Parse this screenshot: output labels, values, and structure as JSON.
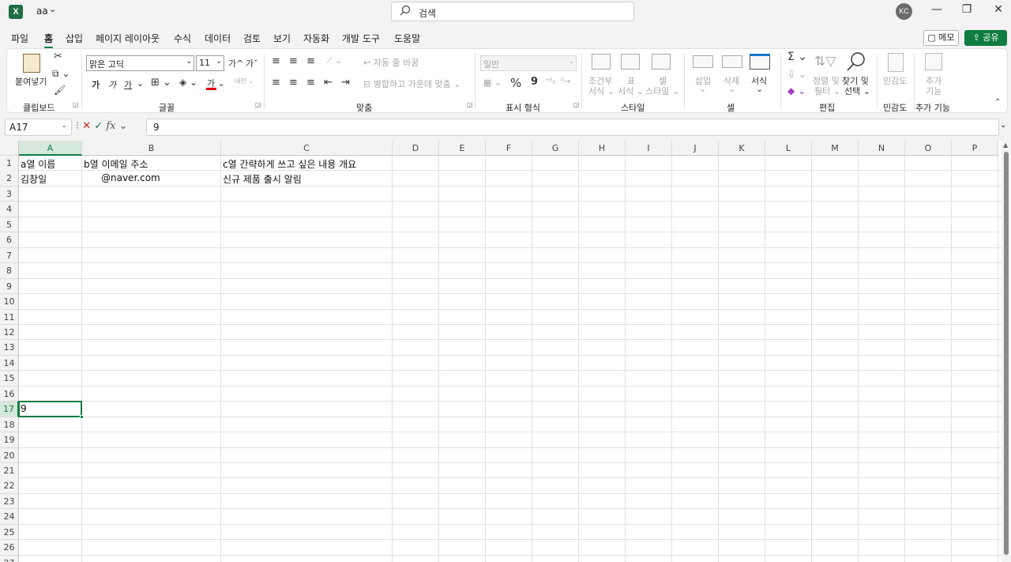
{
  "titlebar": {
    "logo": "X",
    "doc_name": "aa",
    "doc_chevron": "⌄",
    "search_placeholder": "검색",
    "avatar_initials": "KC",
    "minimize": "—",
    "restore": "❐",
    "close": "✕"
  },
  "menu": {
    "tabs": [
      "파일",
      "홈",
      "삽입",
      "페이지 레이아웃",
      "수식",
      "데이터",
      "검토",
      "보기",
      "자동화",
      "개발 도구",
      "도움말"
    ],
    "active": "홈",
    "memo_label": "메모",
    "share_label": "공유"
  },
  "ribbon": {
    "clipboard": {
      "label": "클립보드",
      "paste": "붙여넣기"
    },
    "font": {
      "label": "글꼴",
      "name": "맑은 고딕",
      "size": "11",
      "bold": "가",
      "italic": "가",
      "underline": "가",
      "color_letter": "가",
      "wrap_letter": "내천"
    },
    "alignment": {
      "label": "맞춤",
      "wrap_text": "자동 줄 바꿈",
      "merge_center": "병합하고 가운데 맞춤"
    },
    "number": {
      "label": "표시 형식",
      "format": "일반",
      "percent": "%",
      "comma": "9"
    },
    "styles": {
      "label": "스타일",
      "conditional_1": "조건부",
      "conditional_2": "서식",
      "table_1": "표",
      "table_2": "서식",
      "cell_1": "셀",
      "cell_2": "스타일"
    },
    "cells": {
      "label": "셀",
      "insert": "삽입",
      "delete": "삭제",
      "format": "서식"
    },
    "editing": {
      "label": "편집",
      "sort_1": "정렬 및",
      "sort_2": "필터",
      "find_1": "찾기 및",
      "find_2": "선택"
    },
    "sensitivity": {
      "label": "민감도",
      "btn": "민감도"
    },
    "addins": {
      "label": "추가 기능",
      "btn_1": "추가",
      "btn_2": "기능"
    },
    "accent_red": "#e00000",
    "accent_green": "#107c41"
  },
  "formula_bar": {
    "name_box": "A17",
    "cancel": "✕",
    "enter": "✓",
    "fx": "fx",
    "value": "9"
  },
  "sheet": {
    "columns": [
      "A",
      "B",
      "C",
      "D",
      "E",
      "F",
      "G",
      "H",
      "I",
      "J",
      "K",
      "L",
      "M",
      "N",
      "O",
      "P"
    ],
    "rows": [
      "1",
      "2",
      "3",
      "4",
      "5",
      "6",
      "7",
      "8",
      "9",
      "10",
      "11",
      "12",
      "13",
      "14",
      "15",
      "16",
      "17",
      "18",
      "19",
      "20",
      "21",
      "22",
      "23",
      "24",
      "25",
      "26",
      "27"
    ],
    "selected_column": "A",
    "selected_row": "17",
    "cells": {
      "A1": "a열 이름",
      "B1": "b열 이메일 주소",
      "C1": "c열 간략하게 쓰고 싶은 내용 개요",
      "A2": "김창일",
      "B2": "@naver.com",
      "C2": "신규 제품 출시 알림",
      "A17": "9"
    }
  }
}
